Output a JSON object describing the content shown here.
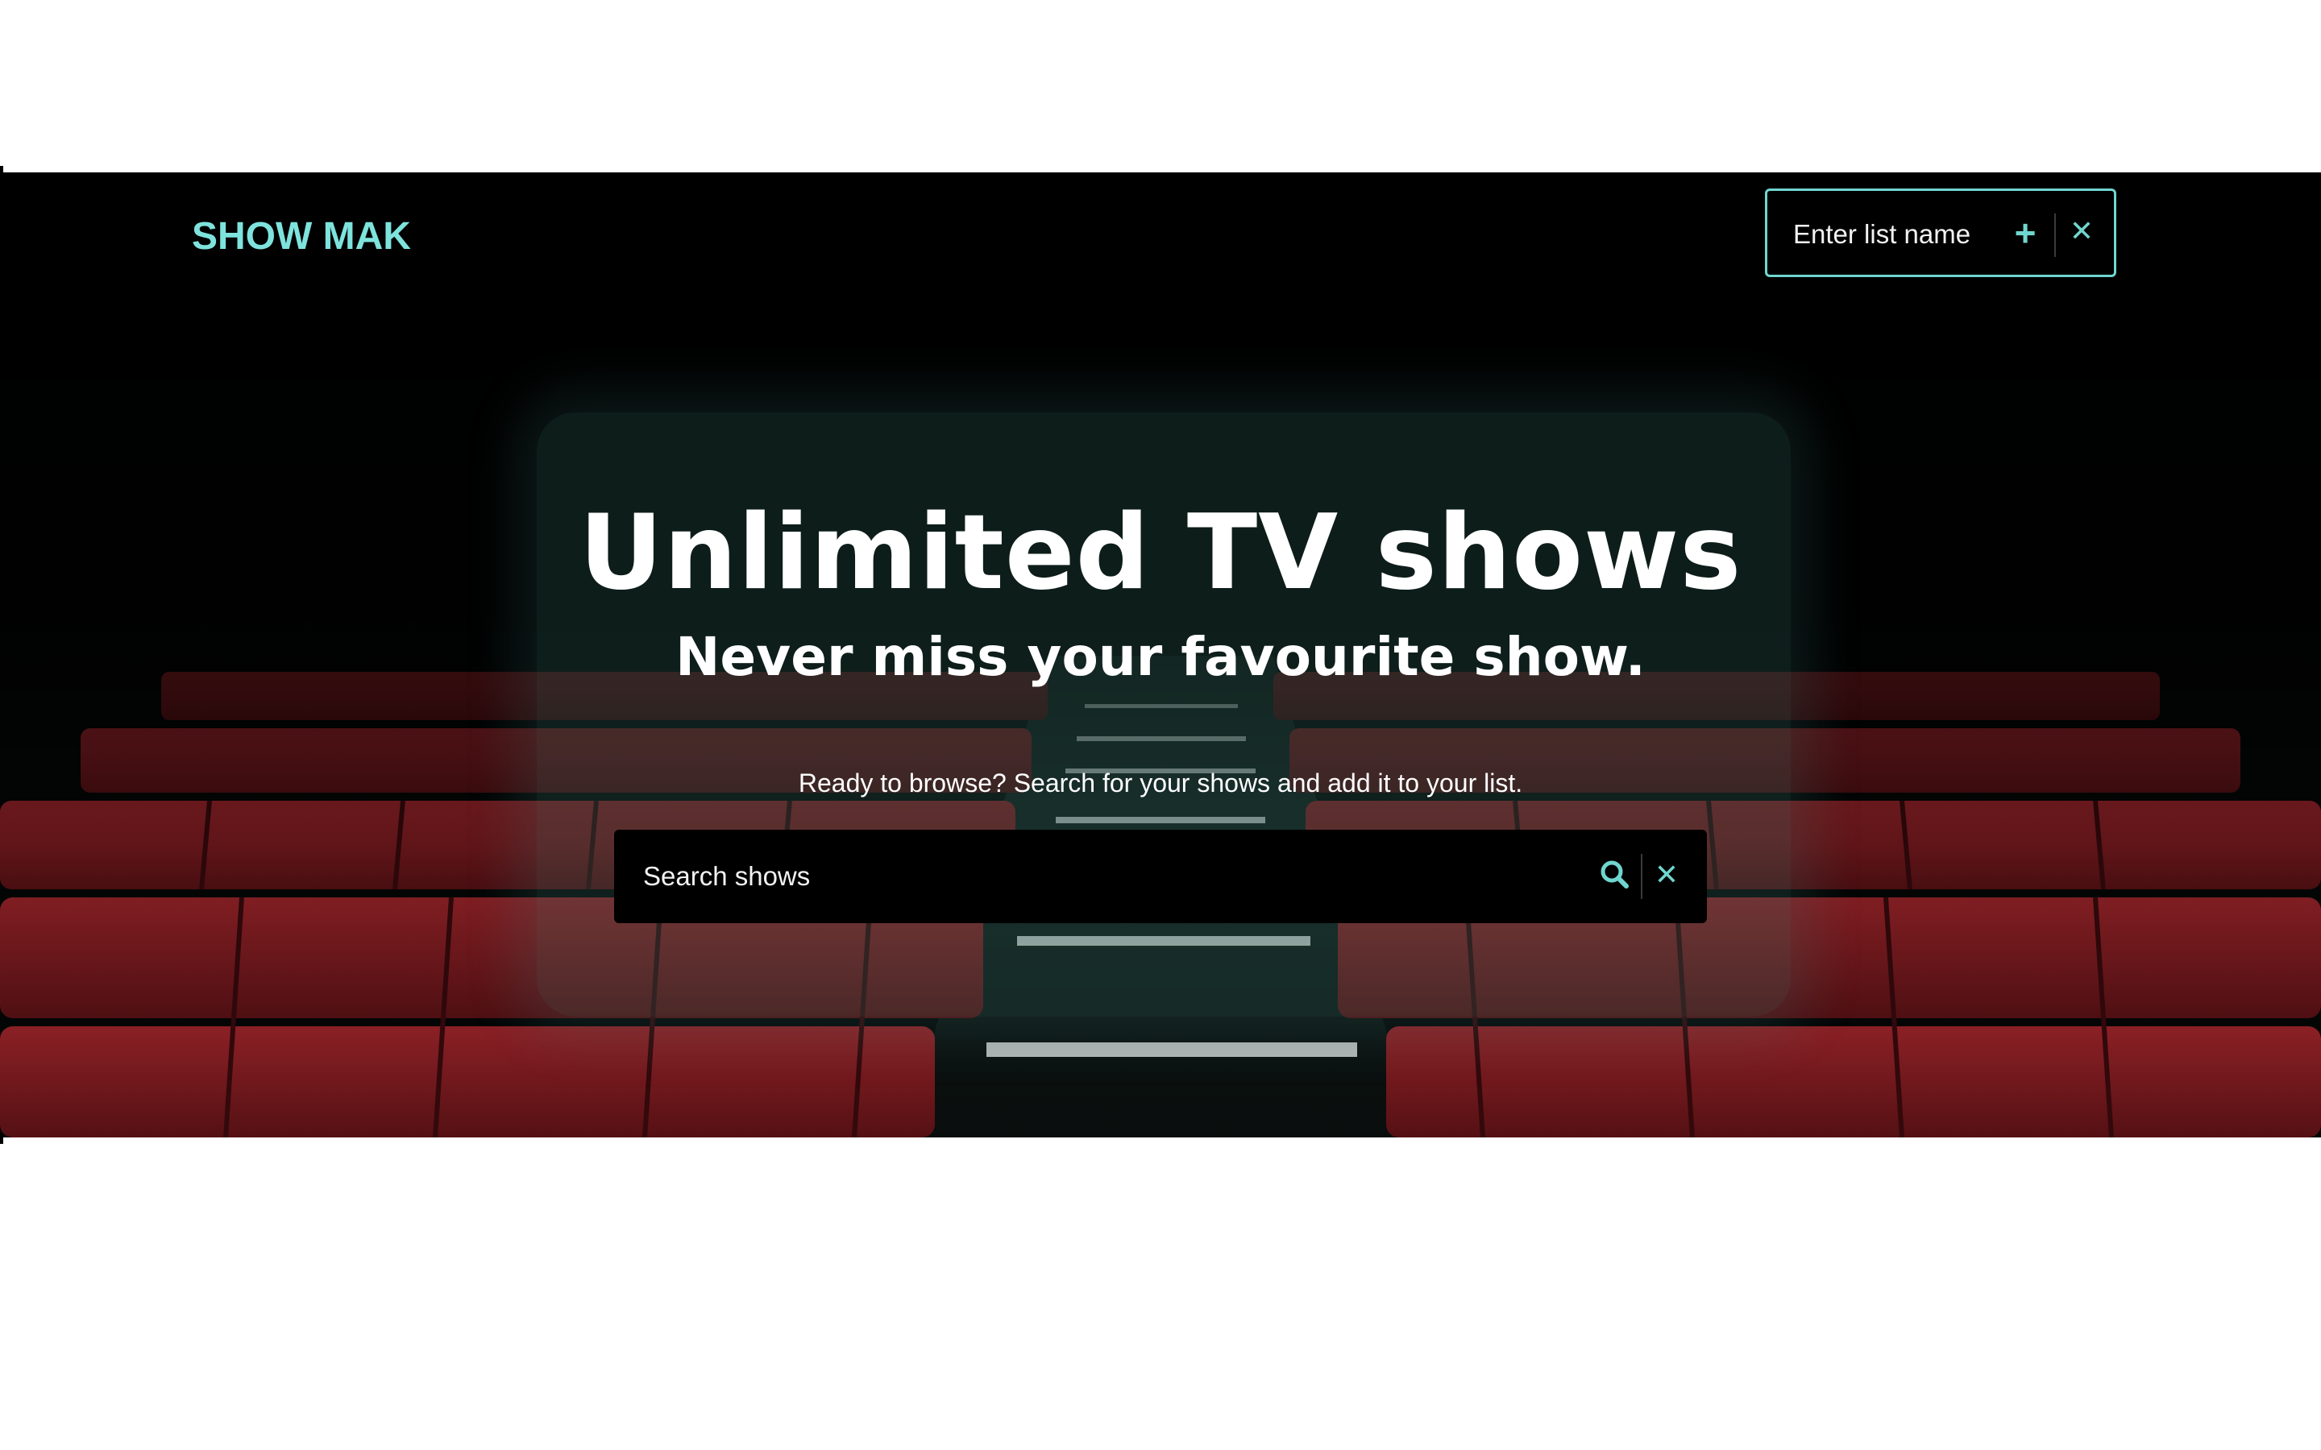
{
  "brand": {
    "name": "SHOW MAK"
  },
  "list_form": {
    "placeholder": "Enter list name",
    "add_icon": "plus-icon",
    "close_icon": "close-icon"
  },
  "hero": {
    "title": "Unlimited TV shows",
    "subtitle": "Never miss your favourite show.",
    "prompt": "Ready to browse? Search for your shows and add it to your list.",
    "background": "cinema-seats-image"
  },
  "search": {
    "placeholder": "Search shows",
    "search_icon": "search-icon",
    "clear_icon": "close-icon"
  },
  "colors": {
    "accent": "#6fd6cf",
    "brand": "#7ee3dc",
    "background": "#000000",
    "seat_red": "#8e1e24"
  }
}
